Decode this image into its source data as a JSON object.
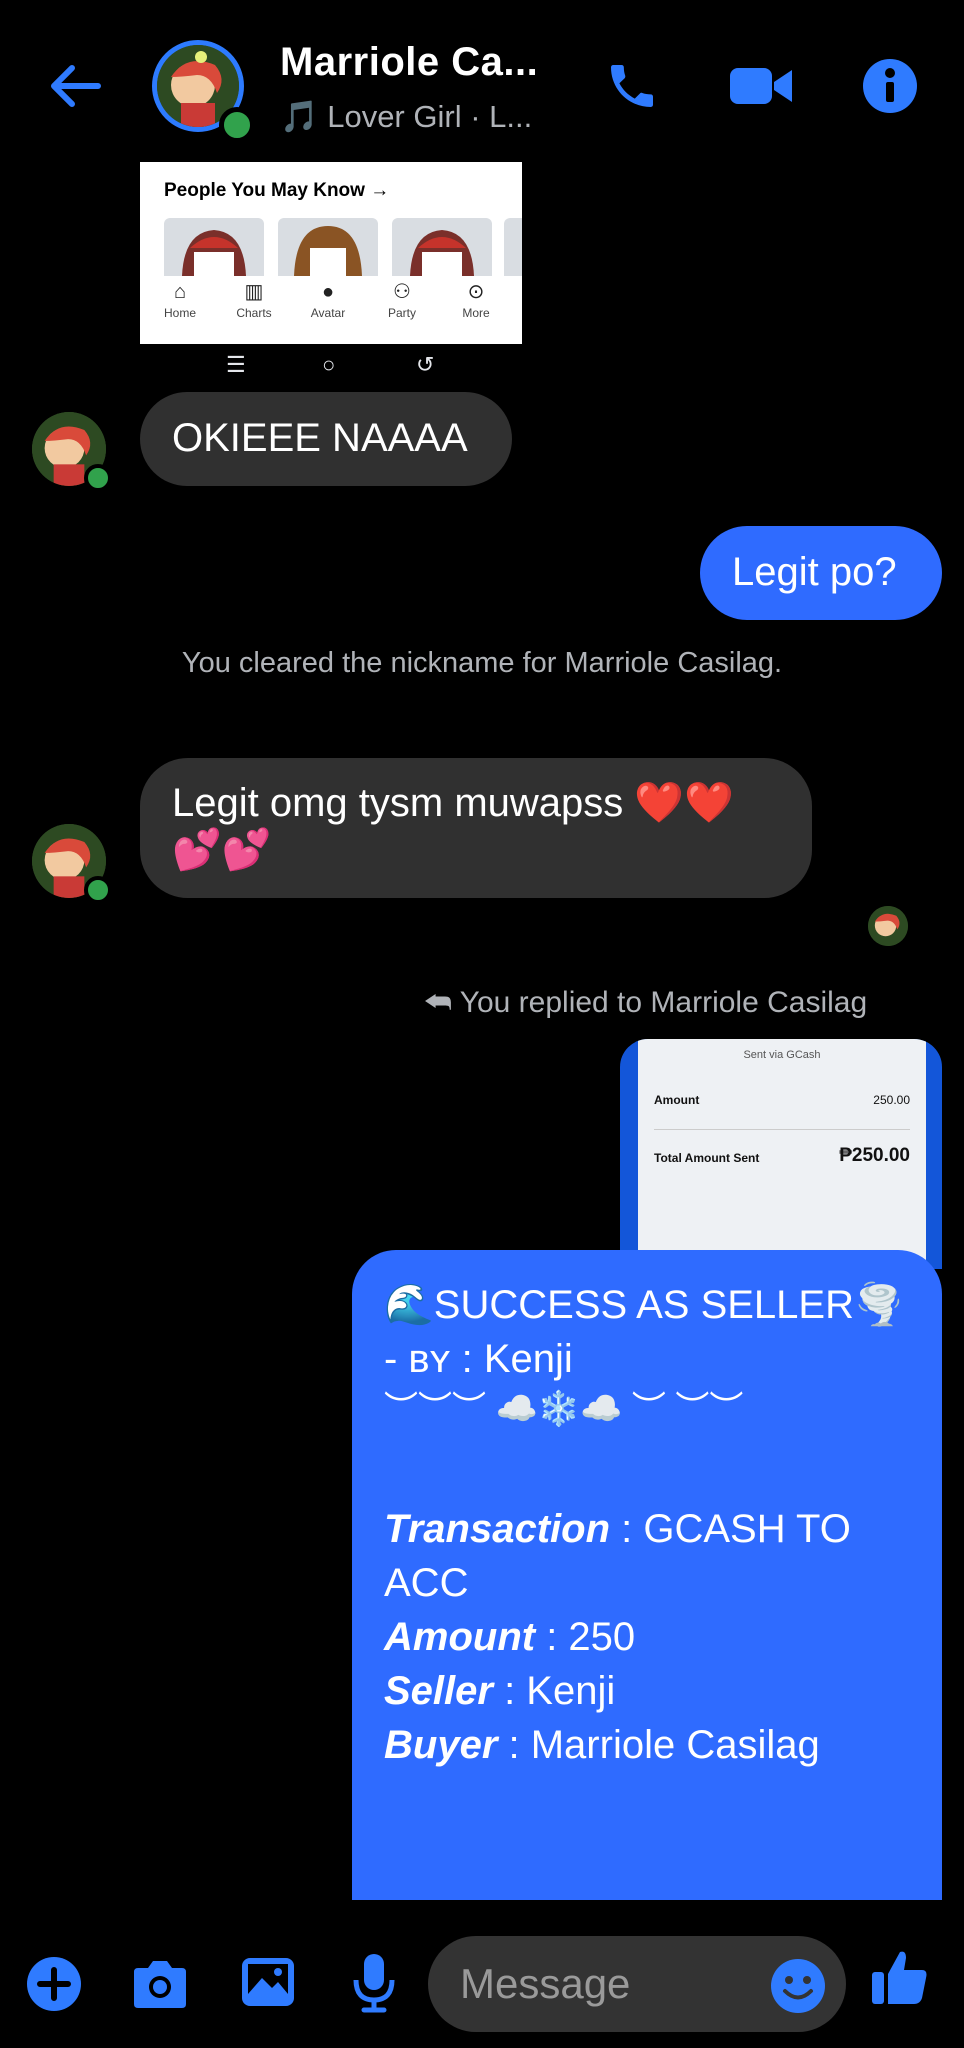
{
  "header": {
    "title": "Marriole Ca...",
    "subtitle": "🎵 Lover Girl · L...",
    "accent": "#2f7bff"
  },
  "shared_screenshot": {
    "title": "People You May Know →",
    "nav_items": [
      {
        "label": "Home",
        "icon": "home-icon"
      },
      {
        "label": "Charts",
        "icon": "charts-icon"
      },
      {
        "label": "Avatar",
        "icon": "avatar-icon"
      },
      {
        "label": "Party",
        "icon": "party-icon"
      },
      {
        "label": "More",
        "icon": "more-icon"
      }
    ]
  },
  "messages": {
    "okieee": "OKIEEE NAAAA",
    "legit_po": "Legit po?",
    "system_nickname": "You cleared the nickname for Marriole Casilag.",
    "legit_omg": "Legit omg tysm muwapss ❤️❤️💕💕",
    "replied_to": "You replied to Marriole Casilag"
  },
  "receipt": {
    "header": "Sent via GCash",
    "amount_label": "Amount",
    "amount_value": "250.00",
    "total_label": "Total Amount Sent",
    "total_value": "₱250.00"
  },
  "seller_message": {
    "line1": "🌊SUCCESS AS SELLER🌪️",
    "line2_prefix": "- ʙʏ : ",
    "line2_name": "Kenji",
    "deco": "︶︶︶ ☁️❄️☁️ ︶ ︶︶",
    "transaction_label": "Transaction",
    "transaction_value": " : GCASH TO ACC",
    "amount_label": "Amount",
    "amount_value": " : 250",
    "seller_label": "Seller",
    "seller_value": " : Kenji",
    "buyer_label": "Buyer",
    "buyer_value": " : Marriole Casilag"
  },
  "composer": {
    "placeholder": "Message"
  }
}
